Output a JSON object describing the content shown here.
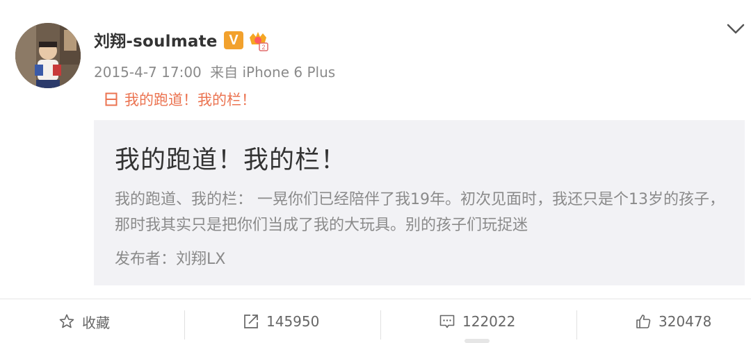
{
  "post": {
    "username": "刘翔-soulmate",
    "verified_badge": "V",
    "member_badge_icon": "crown-member-icon",
    "timestamp": "2015-4-7 17:00",
    "source": "来自 iPhone 6 Plus",
    "topic_icon": "article-icon",
    "topic_text": "我的跑道！我的栏！",
    "menu_icon": "chevron-down-icon"
  },
  "card": {
    "title": "我的跑道！我的栏！",
    "excerpt": "我的跑道、我的栏： 一晃你们已经陪伴了我19年。初次见面时，我还只是个13岁的孩子，那时我其实只是把你们当成了我的大玩具。别的孩子们玩捉迷",
    "author": "发布者：刘翔LX"
  },
  "actions": {
    "favorite_label": "收藏",
    "repost_count": "145950",
    "comment_count": "122022",
    "like_count": "320478"
  },
  "colors": {
    "accent": "#eb7350",
    "verified": "#f2a12d",
    "card_bg": "#f2f2f5",
    "muted_text": "#8a8a8a"
  }
}
